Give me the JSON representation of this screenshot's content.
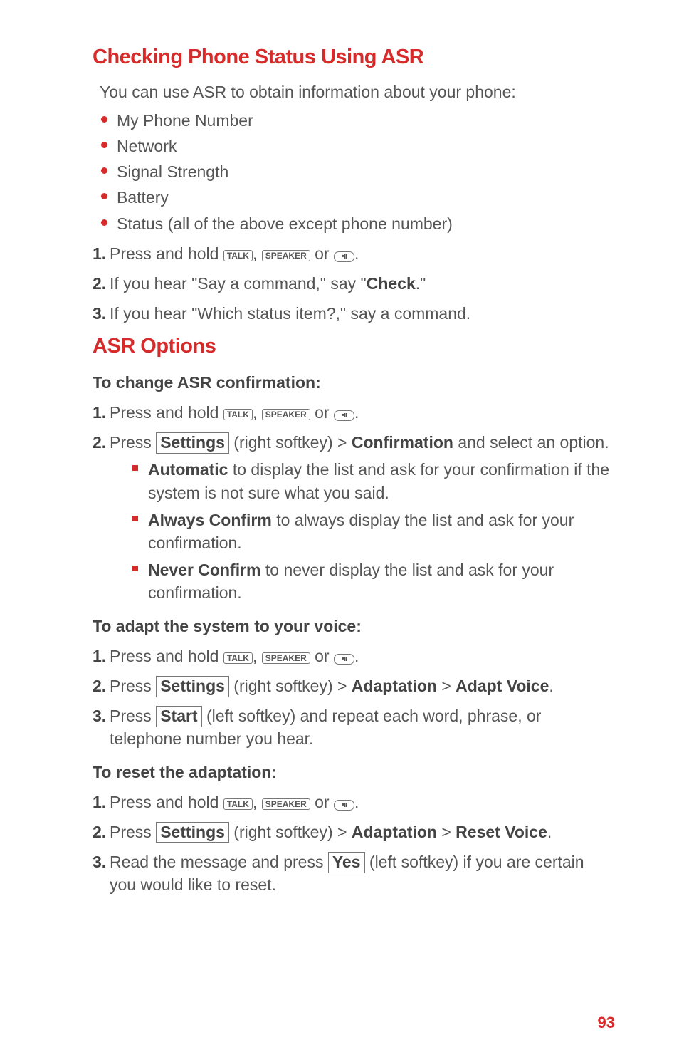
{
  "page_number": "93",
  "keys": {
    "talk": "TALK",
    "speaker": "SPEAKER",
    "dots": "•ıı"
  },
  "softkeys": {
    "settings": "Settings",
    "start": "Start",
    "yes": "Yes"
  },
  "section1": {
    "title": "Checking Phone Status Using ASR",
    "intro": "You can use ASR to obtain information about your phone:",
    "bullets": [
      "My Phone Number",
      "Network",
      "Signal Strength",
      "Battery",
      "Status (all of the above except phone number)"
    ],
    "steps": {
      "n1": "1.",
      "s1a": "Press and hold ",
      "s1b": ", ",
      "s1c": " or ",
      "s1d": ".",
      "n2": "2.",
      "s2a": "If you hear \"Say a command,\" say \"",
      "s2b": "Check",
      "s2c": ".\"",
      "n3": "3.",
      "s3": "If you hear \"Which status item?,\" say a command."
    }
  },
  "section2": {
    "title": "ASR Options",
    "sub1": {
      "title": "To change ASR confirmation:",
      "n1": "1.",
      "s1a": "Press and hold ",
      "s1b": ", ",
      "s1c": " or ",
      "s1d": ".",
      "n2": "2.",
      "s2a": "Press ",
      "s2b": " (right softkey) > ",
      "s2c": "Confirmation",
      "s2d": " and select an option.",
      "opts": {
        "a_b": "Automatic",
        "a_t": " to display the list and ask for your confirmation if the system is not sure what you said.",
        "b_b": "Always Confirm",
        "b_t": " to always display the list and ask for your confirmation.",
        "c_b": "Never Confirm",
        "c_t": " to never display the list and ask for your confirmation."
      }
    },
    "sub2": {
      "title": "To adapt the system to your voice:",
      "n1": "1.",
      "s1a": "Press and hold ",
      "s1b": ", ",
      "s1c": " or ",
      "s1d": ".",
      "n2": "2.",
      "s2a": "Press ",
      "s2b": " (right softkey) > ",
      "s2c": "Adaptation",
      "s2d": " > ",
      "s2e": "Adapt Voice",
      "s2f": ".",
      "n3": "3.",
      "s3a": "Press ",
      "s3b": " (left softkey) and repeat each word, phrase, or telephone number you hear."
    },
    "sub3": {
      "title": "To reset the adaptation:",
      "n1": "1.",
      "s1a": "Press and hold ",
      "s1b": ", ",
      "s1c": " or ",
      "s1d": ".",
      "n2": "2.",
      "s2a": "Press ",
      "s2b": " (right softkey) > ",
      "s2c": "Adaptation",
      "s2d": " > ",
      "s2e": "Reset Voice",
      "s2f": ".",
      "n3": "3.",
      "s3a": "Read the message and press ",
      "s3b": " (left softkey) if you are certain you would like to reset."
    }
  }
}
